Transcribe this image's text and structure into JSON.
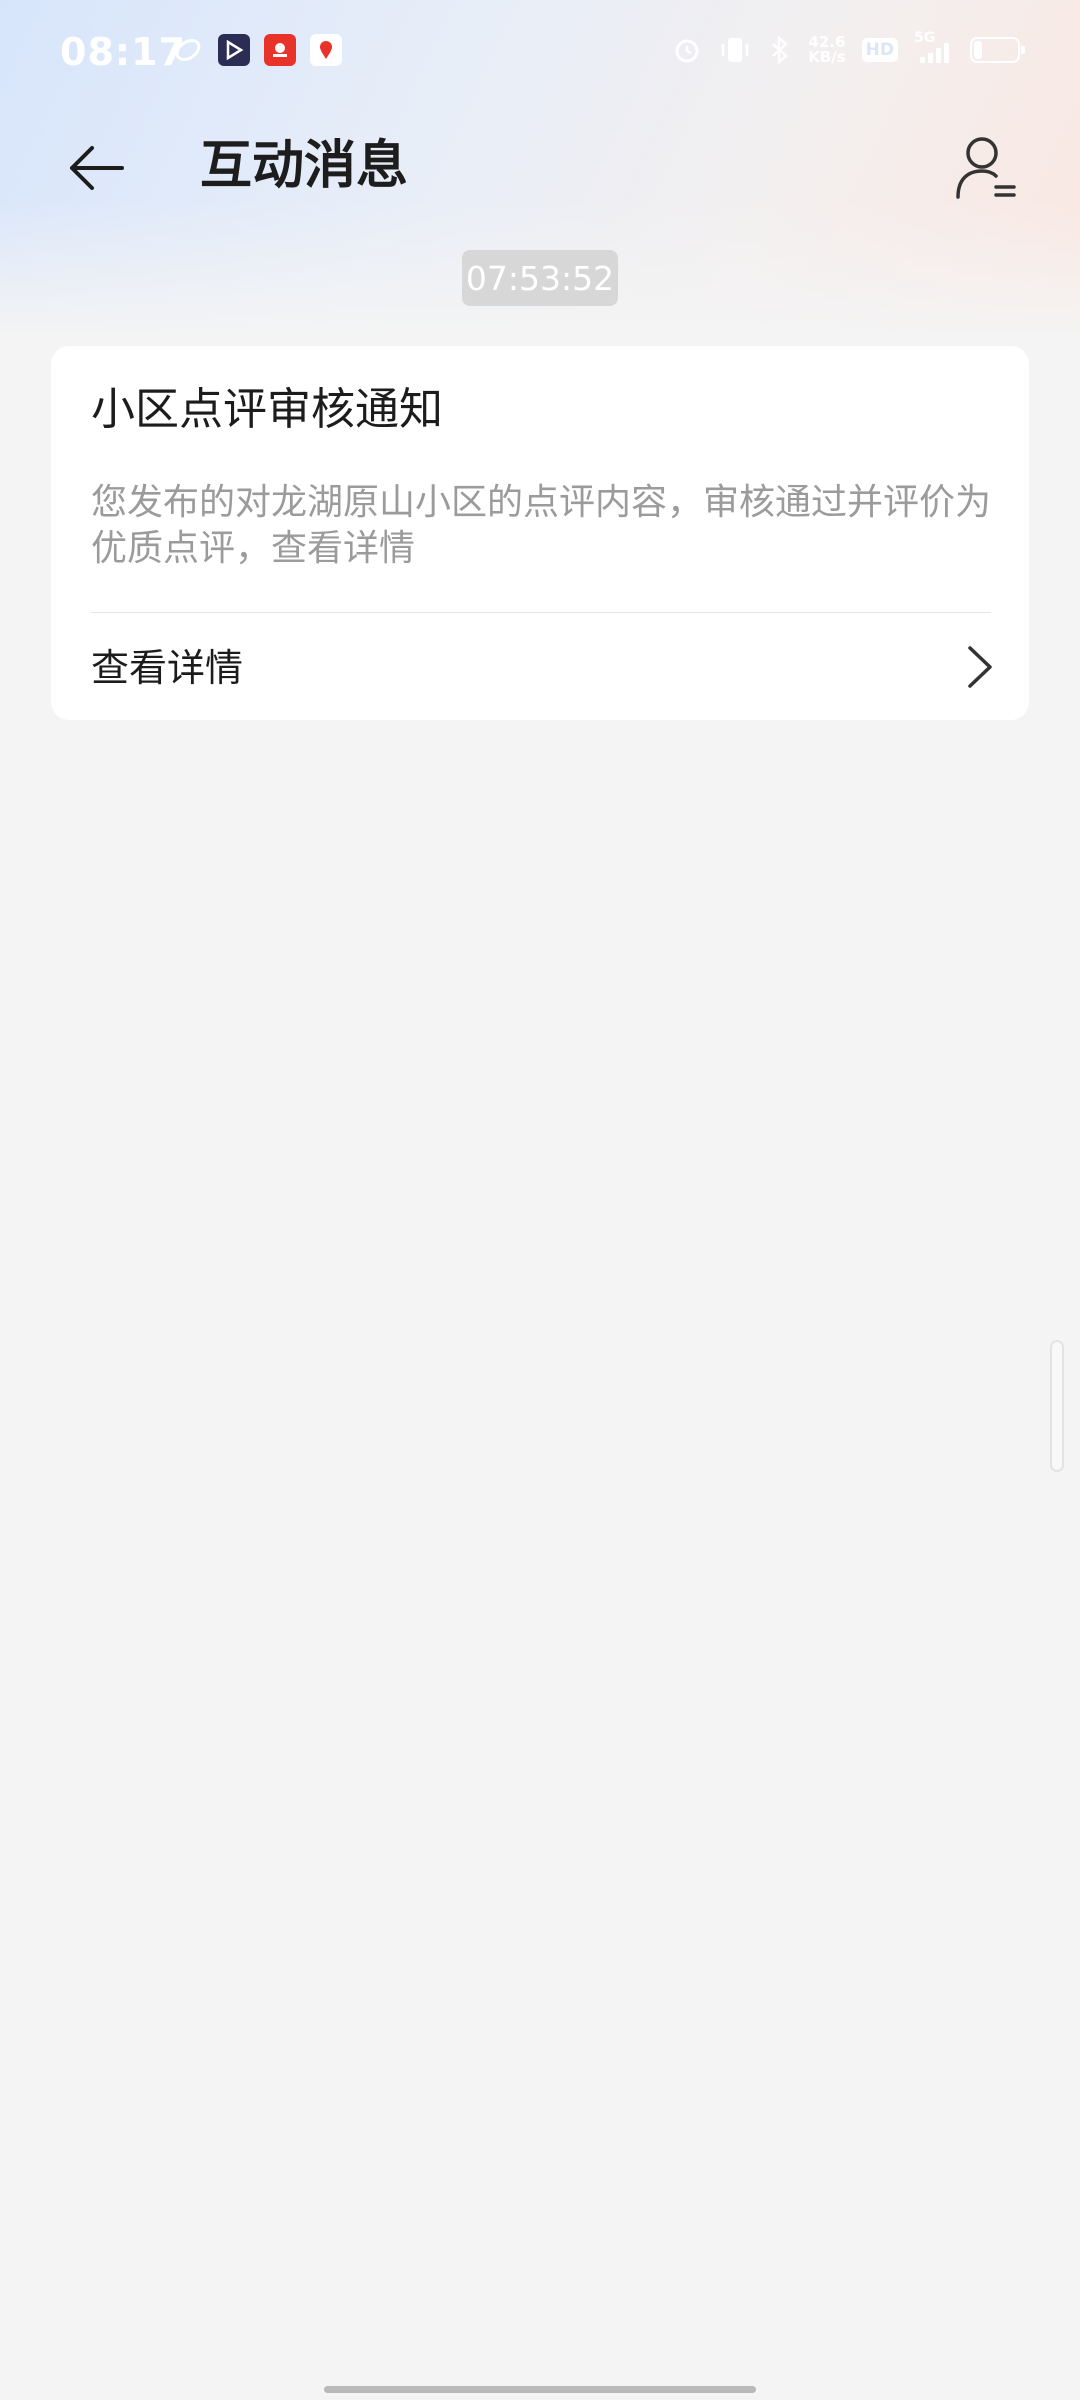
{
  "status_bar": {
    "time": "08:17",
    "network_speed_value": "42.6",
    "network_speed_unit": "KB/s",
    "hd_label": "HD",
    "signal_label": "5G",
    "battery_percent": 20
  },
  "header": {
    "title": "互动消息",
    "back_icon": "arrow-left-icon",
    "user_icon": "user-settings-icon"
  },
  "message": {
    "time": "07:53:52",
    "title": "小区点评审核通知",
    "body": "您发布的对龙湖原山小区的点评内容，审核通过并评价为优质点评，查看详情",
    "link_label": "查看详情"
  }
}
